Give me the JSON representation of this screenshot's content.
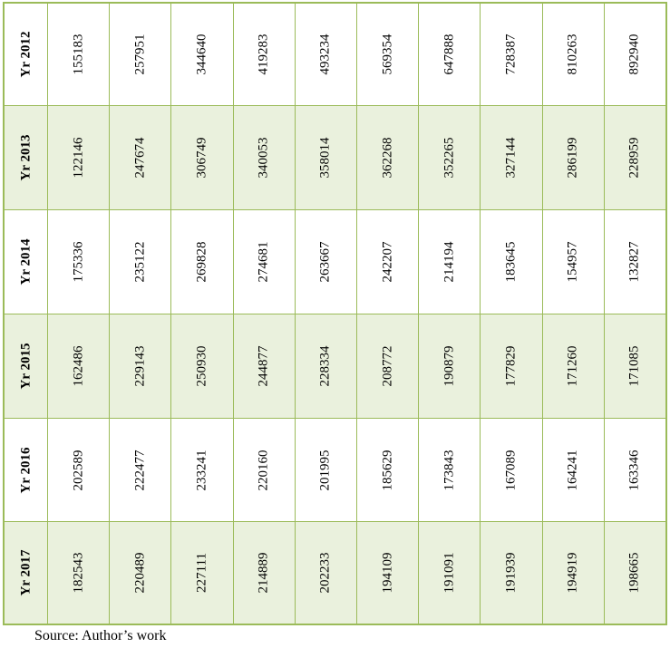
{
  "table": {
    "rows": [
      {
        "label": "Yr 2012",
        "values": [
          "155183",
          "257951",
          "344640",
          "419283",
          "493234",
          "569354",
          "647888",
          "728387",
          "810263",
          "892940"
        ]
      },
      {
        "label": "Yr 2013",
        "values": [
          "122146",
          "247674",
          "306749",
          "340053",
          "358014",
          "362268",
          "352265",
          "327144",
          "286199",
          "228959"
        ]
      },
      {
        "label": "Yr 2014",
        "values": [
          "175336",
          "235122",
          "269828",
          "274681",
          "263667",
          "242207",
          "214194",
          "183645",
          "154957",
          "132827"
        ]
      },
      {
        "label": "Yr 2015",
        "values": [
          "162486",
          "229143",
          "250930",
          "244877",
          "228334",
          "208772",
          "190879",
          "177829",
          "171260",
          "171085"
        ]
      },
      {
        "label": "Yr 2016",
        "values": [
          "202589",
          "222477",
          "233241",
          "220160",
          "201995",
          "185629",
          "173843",
          "167089",
          "164241",
          "163346"
        ]
      },
      {
        "label": "Yr 2017",
        "values": [
          "182543",
          "220489",
          "227111",
          "214889",
          "202233",
          "194109",
          "191091",
          "191939",
          "194919",
          "198665"
        ]
      }
    ]
  },
  "footer": {
    "source": "Source: Author’s work"
  },
  "colors": {
    "border": "#9bbb59",
    "alt_row_fill": "#eaf1dd"
  }
}
